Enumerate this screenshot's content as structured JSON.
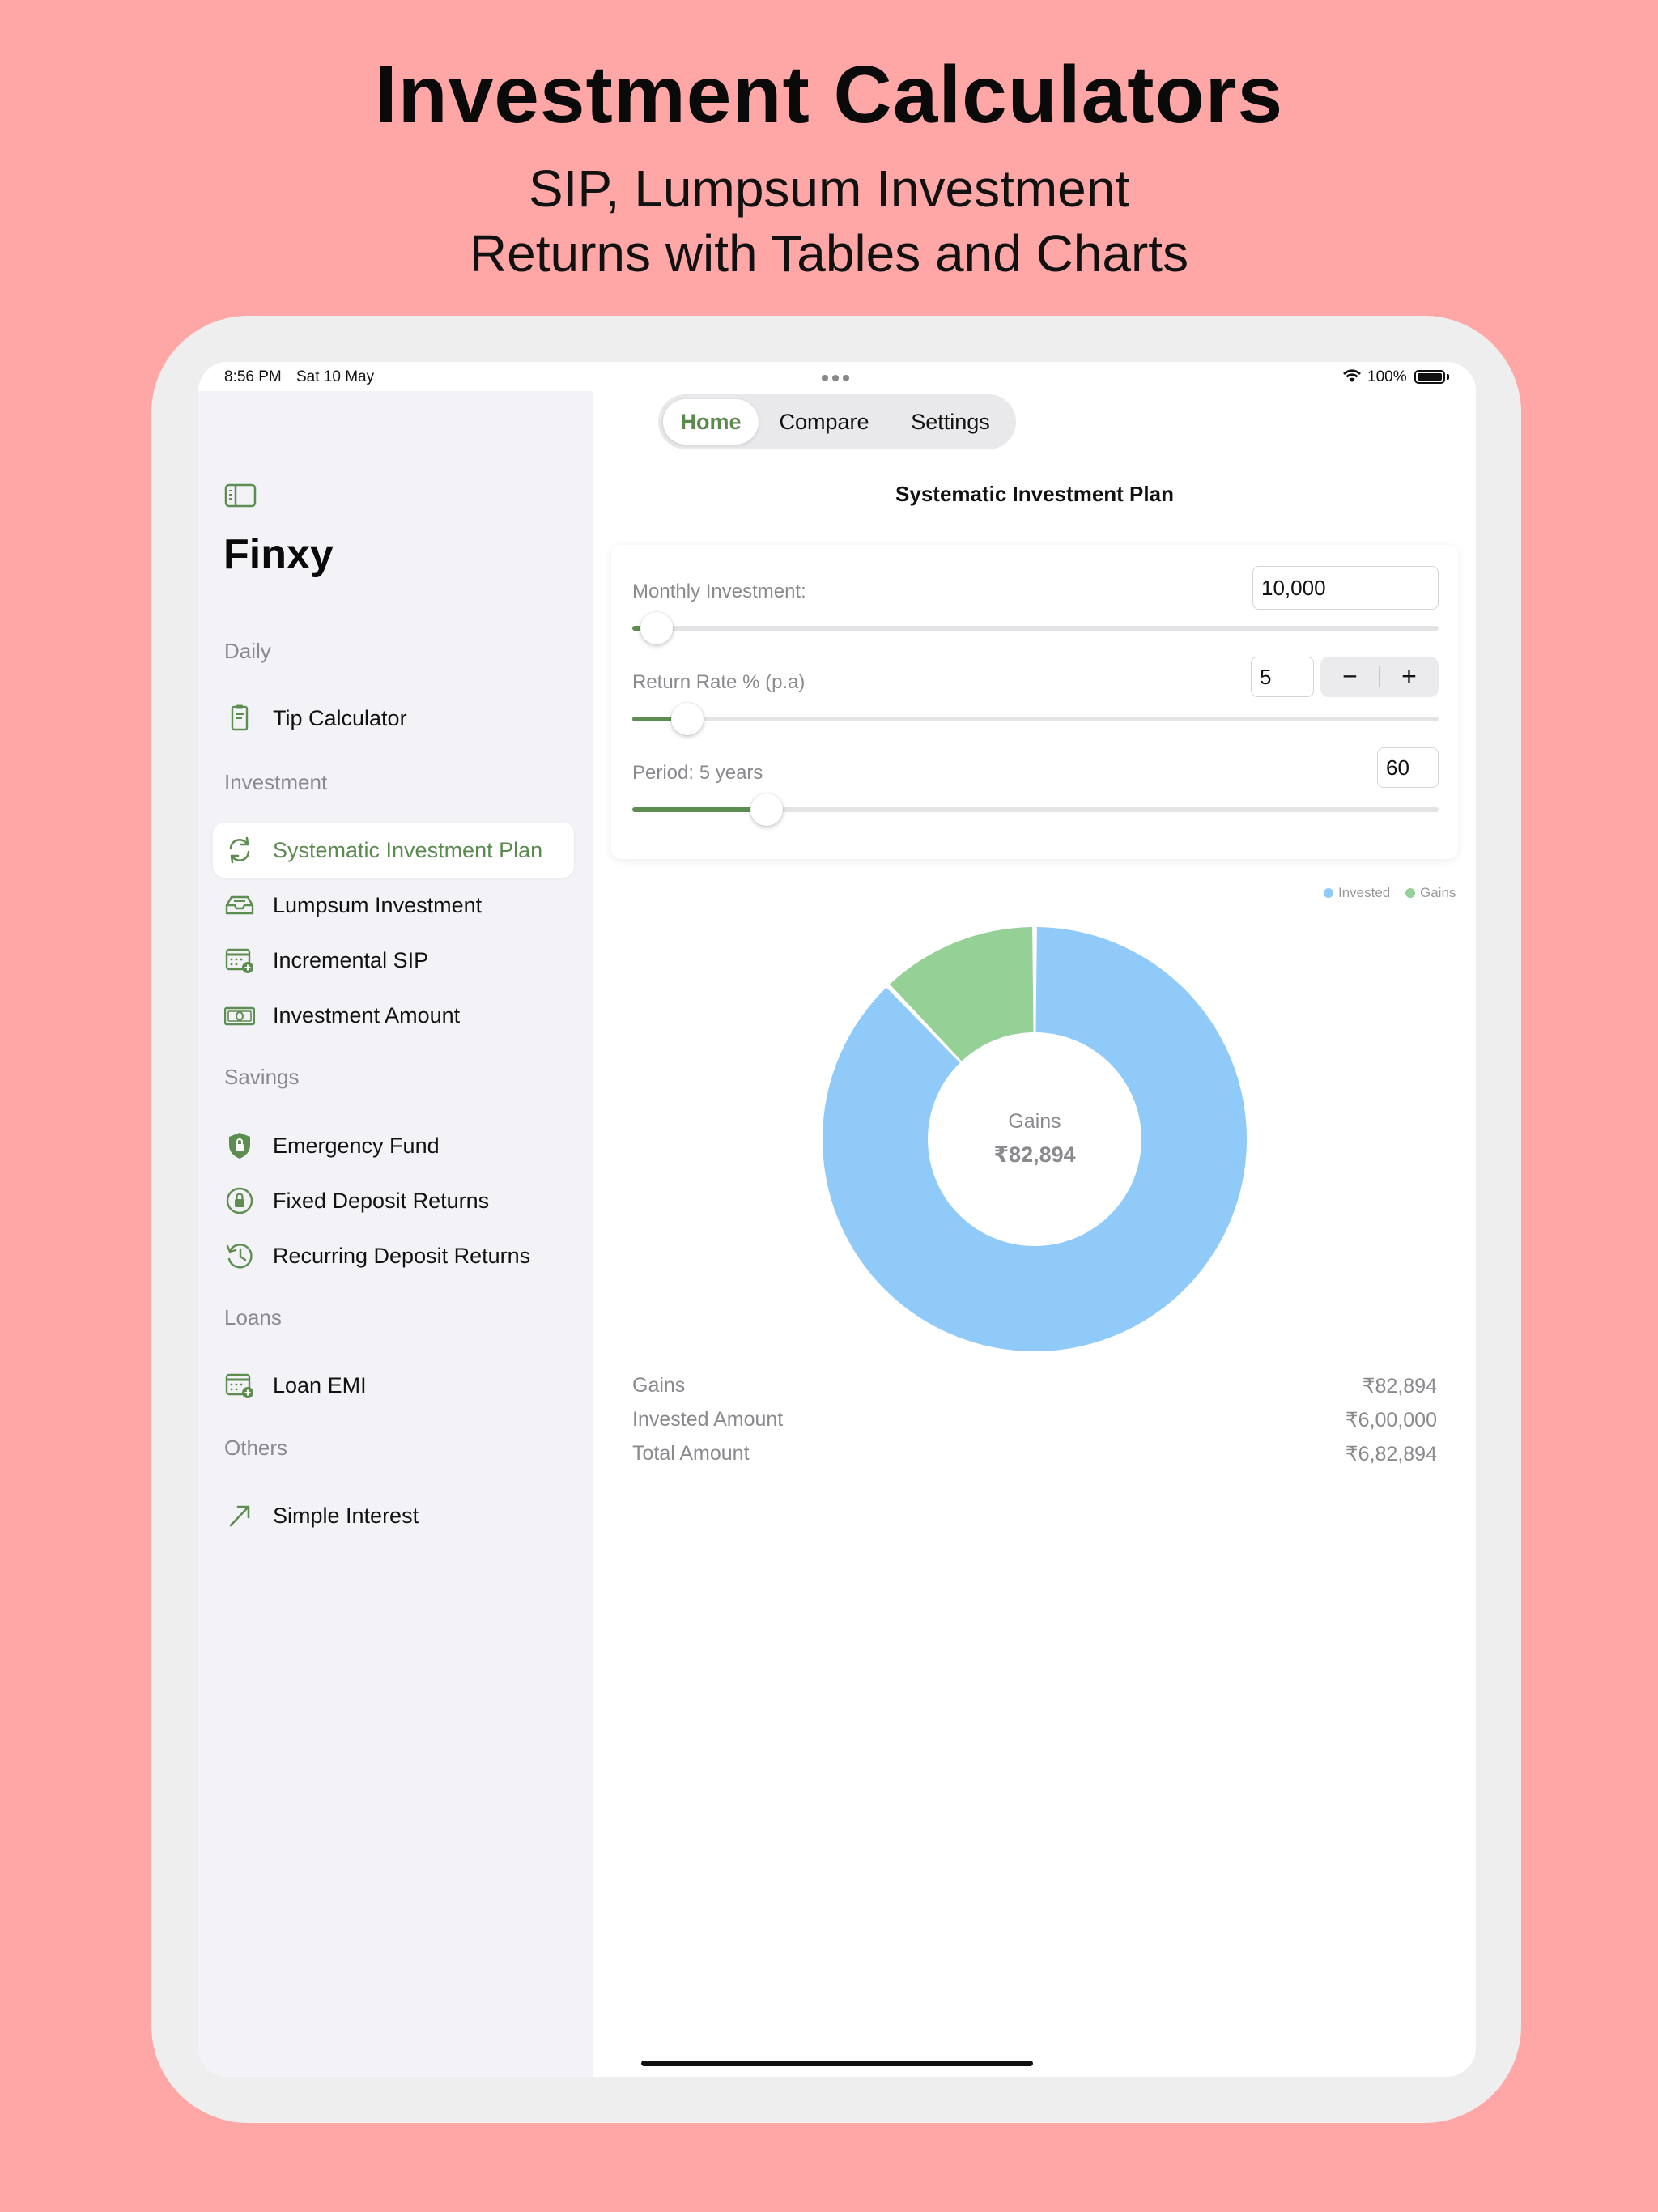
{
  "hero": {
    "title": "Investment Calculators",
    "subtitle_line1": "SIP, Lumpsum Investment",
    "subtitle_line2": "Returns with Tables and Charts"
  },
  "status_bar": {
    "time": "8:56 PM",
    "date": "Sat 10 May",
    "battery": "100%"
  },
  "sidebar": {
    "app_name": "Finxy",
    "sections": [
      {
        "label": "Daily",
        "items": [
          {
            "label": "Tip Calculator",
            "icon": "receipt-icon"
          }
        ]
      },
      {
        "label": "Investment",
        "items": [
          {
            "label": "Systematic Investment Plan",
            "icon": "recurring-arrows-icon",
            "selected": true
          },
          {
            "label": "Lumpsum Investment",
            "icon": "tray-icon"
          },
          {
            "label": "Incremental SIP",
            "icon": "calendar-plus-icon"
          },
          {
            "label": "Investment Amount",
            "icon": "banknote-icon"
          }
        ]
      },
      {
        "label": "Savings",
        "items": [
          {
            "label": "Emergency Fund",
            "icon": "shield-lock-icon"
          },
          {
            "label": "Fixed Deposit Returns",
            "icon": "lock-circle-icon"
          },
          {
            "label": "Recurring Deposit Returns",
            "icon": "clock-history-icon"
          }
        ]
      },
      {
        "label": "Loans",
        "items": [
          {
            "label": "Loan EMI",
            "icon": "calendar-plus-icon"
          }
        ]
      },
      {
        "label": "Others",
        "items": [
          {
            "label": "Simple Interest",
            "icon": "arrow-up-right-icon"
          }
        ]
      }
    ]
  },
  "tabs": [
    {
      "label": "Home",
      "active": true
    },
    {
      "label": "Compare",
      "active": false
    },
    {
      "label": "Settings",
      "active": false
    }
  ],
  "page_title": "Systematic Investment Plan",
  "form": {
    "monthly_investment": {
      "label": "Monthly Investment:",
      "value": "10,000",
      "slider_fraction": 0.03
    },
    "return_rate": {
      "label": "Return Rate % (p.a)",
      "value": "5",
      "slider_fraction": 0.068,
      "minus": "−",
      "plus": "+"
    },
    "period": {
      "label": "Period: 5 years",
      "value": "60",
      "slider_fraction": 0.167
    }
  },
  "chart_data": {
    "type": "pie",
    "donut": true,
    "categories": [
      "Invested",
      "Gains"
    ],
    "values": [
      600000,
      82894
    ],
    "colors": [
      "#90CAF9",
      "#95D096"
    ],
    "legend_position": "top-right",
    "center_label": "Gains",
    "center_value": "₹82,894"
  },
  "summary": [
    {
      "label": "Gains",
      "value": "₹82,894"
    },
    {
      "label": "Invested Amount",
      "value": "₹6,00,000"
    },
    {
      "label": "Total Amount",
      "value": "₹6,82,894"
    }
  ],
  "colors": {
    "accent": "#5E8D52",
    "background": "#FFA7A6",
    "sidebar": "#F2F2F7"
  }
}
